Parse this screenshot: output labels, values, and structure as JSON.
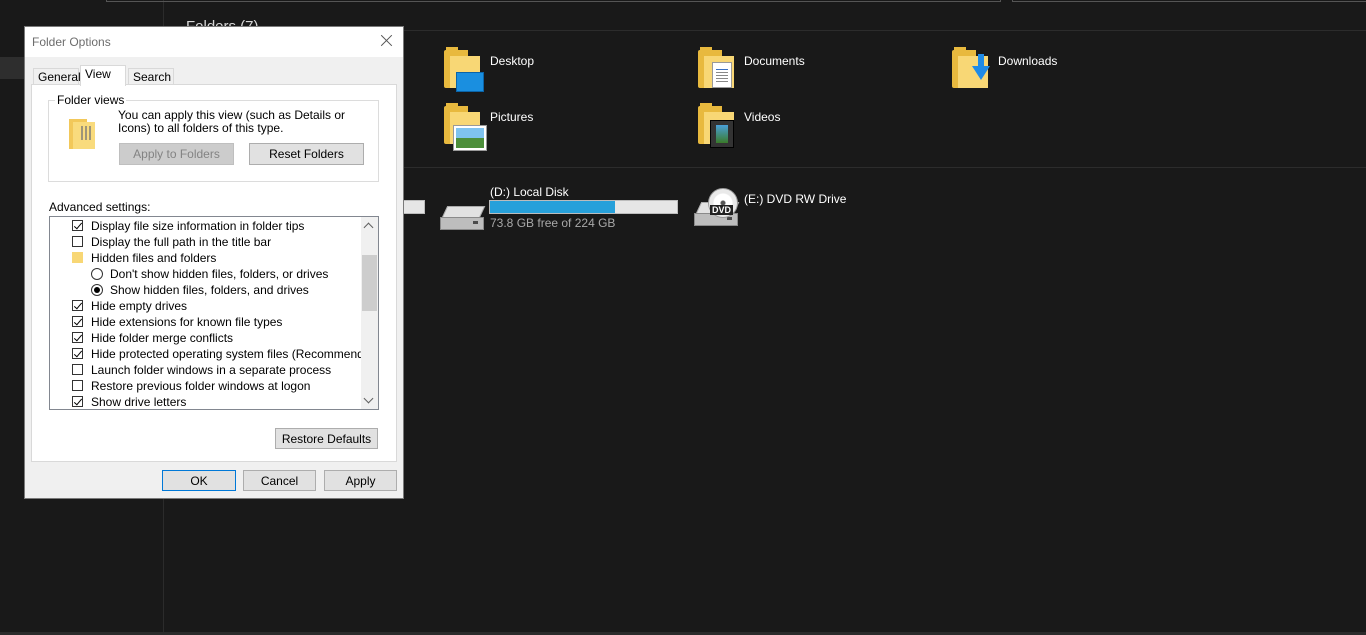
{
  "explorer": {
    "group_header": "Folders (7)",
    "folders": [
      {
        "name": "Desktop",
        "icon": "desktop-folder-icon"
      },
      {
        "name": "Documents",
        "icon": "documents-folder-icon"
      },
      {
        "name": "Downloads",
        "icon": "downloads-folder-icon"
      },
      {
        "name": "Pictures",
        "icon": "pictures-folder-icon"
      },
      {
        "name": "Videos",
        "icon": "videos-folder-icon"
      }
    ],
    "drives": [
      {
        "name": "(D:) Local Disk",
        "free_text": "73.8 GB free of 224 GB",
        "used_fraction": 0.67,
        "icon": "hard-drive-icon"
      },
      {
        "name": "(E:) DVD RW Drive",
        "icon": "dvd-drive-icon",
        "badge": "DVD"
      }
    ],
    "colors": {
      "background": "#191919",
      "bar_fill": "#26a0da"
    }
  },
  "dialog": {
    "title": "Folder Options",
    "tabs": [
      {
        "label": "General",
        "active": false
      },
      {
        "label": "View",
        "active": true
      },
      {
        "label": "Search",
        "active": false
      }
    ],
    "folder_views": {
      "legend": "Folder views",
      "description": "You can apply this view (such as Details or Icons) to all folders of this type.",
      "apply_button": "Apply to Folders",
      "reset_button": "Reset Folders"
    },
    "advanced_label": "Advanced settings:",
    "settings": [
      {
        "type": "checkbox",
        "checked": true,
        "label": "Display file size information in folder tips",
        "indent": 0
      },
      {
        "type": "checkbox",
        "checked": false,
        "label": "Display the full path in the title bar",
        "indent": 0
      },
      {
        "type": "folder",
        "label": "Hidden files and folders",
        "indent": 0
      },
      {
        "type": "radio",
        "checked": false,
        "label": "Don't show hidden files, folders, or drives",
        "indent": 1
      },
      {
        "type": "radio",
        "checked": true,
        "label": "Show hidden files, folders, and drives",
        "indent": 1
      },
      {
        "type": "checkbox",
        "checked": true,
        "label": "Hide empty drives",
        "indent": 0
      },
      {
        "type": "checkbox",
        "checked": true,
        "label": "Hide extensions for known file types",
        "indent": 0
      },
      {
        "type": "checkbox",
        "checked": true,
        "label": "Hide folder merge conflicts",
        "indent": 0
      },
      {
        "type": "checkbox",
        "checked": true,
        "label": "Hide protected operating system files (Recommended)",
        "indent": 0
      },
      {
        "type": "checkbox",
        "checked": false,
        "label": "Launch folder windows in a separate process",
        "indent": 0
      },
      {
        "type": "checkbox",
        "checked": false,
        "label": "Restore previous folder windows at logon",
        "indent": 0
      },
      {
        "type": "checkbox",
        "checked": true,
        "label": "Show drive letters",
        "indent": 0
      }
    ],
    "restore_defaults": "Restore Defaults",
    "ok": "OK",
    "cancel": "Cancel",
    "apply": "Apply"
  }
}
